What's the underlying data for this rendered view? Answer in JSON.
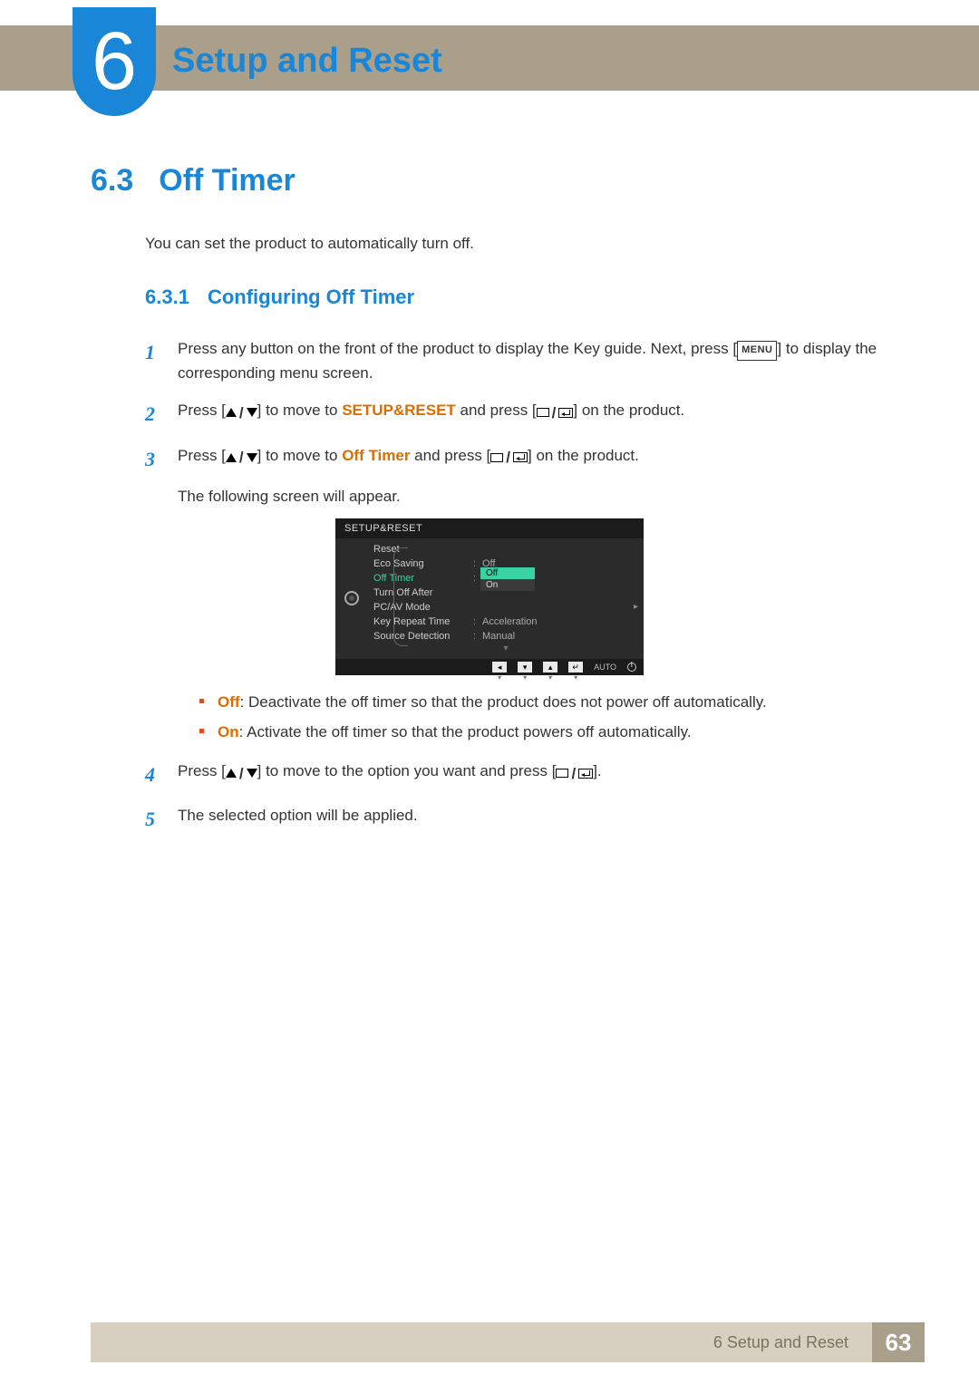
{
  "chapter": {
    "number": "6",
    "title": "Setup and Reset"
  },
  "section": {
    "number": "6.3",
    "title": "Off Timer"
  },
  "intro": "You can set the product to automatically turn off.",
  "subsection": {
    "number": "6.3.1",
    "title": "Configuring Off Timer"
  },
  "steps": {
    "s1_a": "Press any button on the front of the product to display the Key guide. Next, press [",
    "s1_menu": "MENU",
    "s1_b": "] to display the corresponding menu screen.",
    "s2_a": "Press [",
    "s2_b": "] to move to ",
    "s2_hl": "SETUP&RESET",
    "s2_c": " and press [",
    "s2_d": "] on the product.",
    "s3_a": "Press [",
    "s3_b": "] to move to ",
    "s3_hl": "Off Timer",
    "s3_c": " and press [",
    "s3_d": "] on the product.",
    "s3_note": "The following screen will appear.",
    "s4_a": "Press [",
    "s4_b": "] to move to the option you want and press [",
    "s4_c": "].",
    "s5": "The selected option will be applied."
  },
  "bullets": {
    "off_label": "Off",
    "off_text": ": Deactivate the off timer so that the product does not power off automatically.",
    "on_label": "On",
    "on_text": ": Activate the off timer so that the product powers off automatically."
  },
  "osd": {
    "title": "SETUP&RESET",
    "rows": [
      {
        "label": "Reset",
        "value": ""
      },
      {
        "label": "Eco Saving",
        "value": "Off"
      },
      {
        "label": "Off Timer",
        "value": "Off",
        "active": true
      },
      {
        "label": "Turn Off After",
        "value": ""
      },
      {
        "label": "PC/AV Mode",
        "value": ""
      },
      {
        "label": "Key Repeat Time",
        "value": "Acceleration"
      },
      {
        "label": "Source Detection",
        "value": "Manual"
      }
    ],
    "dropdown": [
      "Off",
      "On"
    ],
    "footer_auto": "AUTO"
  },
  "footer": {
    "text": "6 Setup and Reset",
    "page": "63"
  }
}
